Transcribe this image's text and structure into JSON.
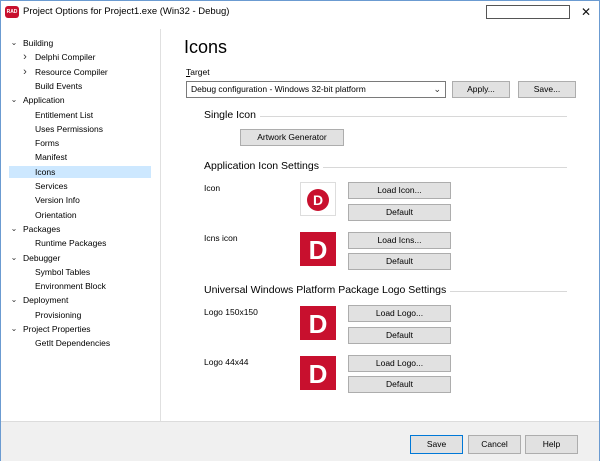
{
  "titlebar": {
    "app_badge": "RAD",
    "title": "Project Options for Project1.exe  (Win32 - Debug)",
    "close_glyph": "✕"
  },
  "sidebar": {
    "items": [
      {
        "label": "Building",
        "level": 0,
        "expander": "chevron-down"
      },
      {
        "label": "Delphi Compiler",
        "level": 1,
        "expander": "chevron-right"
      },
      {
        "label": "Resource Compiler",
        "level": 1,
        "expander": "chevron-right"
      },
      {
        "label": "Build Events",
        "level": 1
      },
      {
        "label": "Application",
        "level": 0,
        "expander": "chevron-down"
      },
      {
        "label": "Entitlement List",
        "level": 1
      },
      {
        "label": "Uses Permissions",
        "level": 1
      },
      {
        "label": "Forms",
        "level": 1
      },
      {
        "label": "Manifest",
        "level": 1
      },
      {
        "label": "Icons",
        "level": 1,
        "selected": true
      },
      {
        "label": "Services",
        "level": 1
      },
      {
        "label": "Version Info",
        "level": 1
      },
      {
        "label": "Orientation",
        "level": 1
      },
      {
        "label": "Packages",
        "level": 0,
        "expander": "chevron-down"
      },
      {
        "label": "Runtime Packages",
        "level": 1
      },
      {
        "label": "Debugger",
        "level": 0,
        "expander": "chevron-down"
      },
      {
        "label": "Symbol Tables",
        "level": 1
      },
      {
        "label": "Environment Block",
        "level": 1
      },
      {
        "label": "Deployment",
        "level": 0,
        "expander": "chevron-down"
      },
      {
        "label": "Provisioning",
        "level": 1
      },
      {
        "label": "Project Properties",
        "level": 0,
        "expander": "chevron-down"
      },
      {
        "label": "GetIt Dependencies",
        "level": 1
      }
    ],
    "selected_color": "#cde8ff"
  },
  "main": {
    "title": "Icons",
    "target_label_first": "T",
    "target_label_rest": "arget",
    "target_value": "Debug configuration - Windows 32-bit platform",
    "apply_label": "Apply...",
    "save_label": "Save...",
    "single_icon_title": "Single Icon",
    "artwork_button": "Artwork Generator",
    "app_icon_settings_title": "Application Icon Settings",
    "icon_label": "Icon",
    "load_icon": "Load Icon...",
    "icns_label": "Icns icon",
    "load_icns": "Load Icns...",
    "uwp_title": "Universal Windows Platform Package Logo Settings",
    "logo150_label": "Logo 150x150",
    "logo44_label": "Logo 44x44",
    "load_logo": "Load Logo...",
    "default_label": "Default",
    "brand_red": "#c8102e"
  },
  "footer": {
    "save": "Save",
    "cancel": "Cancel",
    "help": "Help"
  }
}
